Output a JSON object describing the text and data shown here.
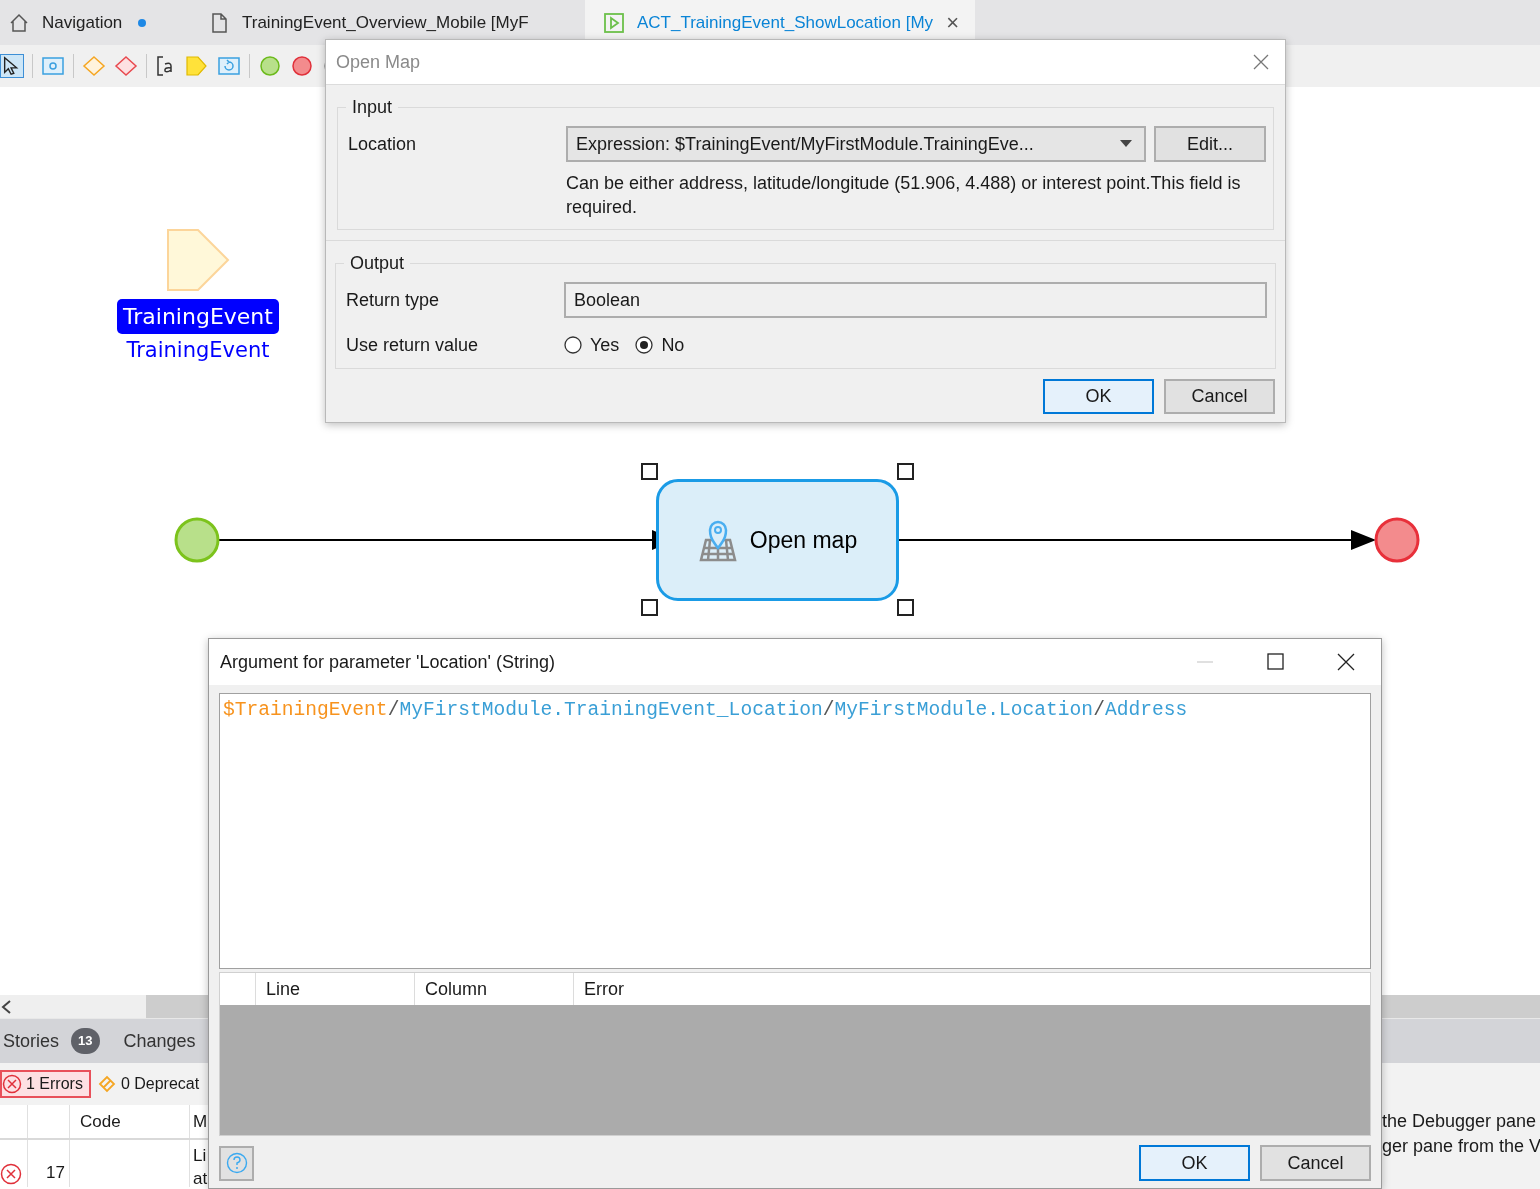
{
  "tabs": [
    {
      "label": "Navigation",
      "unsaved": true,
      "selected": false
    },
    {
      "label": "TrainingEvent_Overview_Mobile [MyF",
      "unsaved": false,
      "selected": false
    },
    {
      "label": "ACT_TrainingEvent_ShowLocation [My",
      "unsaved": false,
      "selected": true,
      "close": "×"
    }
  ],
  "canvas": {
    "parameter": {
      "badge": "TrainingEvent",
      "name": "TrainingEvent"
    },
    "activity": {
      "label": "Open map",
      "selected": true
    }
  },
  "open_map_dialog": {
    "title": "Open Map",
    "input": {
      "legend": "Input",
      "location_label": "Location",
      "location_value": "Expression: $TrainingEvent/MyFirstModule.TrainingEve...",
      "edit_button": "Edit...",
      "hint": "Can be either address, latitude/longitude (51.906, 4.488) or interest point.This field is required."
    },
    "output": {
      "legend": "Output",
      "return_type_label": "Return type",
      "return_type": "Boolean",
      "use_return_label": "Use return value",
      "options": [
        {
          "label": "Yes",
          "selected": false
        },
        {
          "label": "No",
          "selected": true
        }
      ]
    },
    "buttons": [
      "OK",
      "Cancel"
    ]
  },
  "argument_dialog": {
    "title": "Argument for parameter 'Location' (String)",
    "expression": [
      {
        "kind": "variable",
        "text": "$TrainingEvent"
      },
      {
        "kind": "separator",
        "text": "/"
      },
      {
        "kind": "member",
        "text": "MyFirstModule.TrainingEvent_Location"
      },
      {
        "kind": "separator",
        "text": "/"
      },
      {
        "kind": "member",
        "text": "MyFirstModule.Location"
      },
      {
        "kind": "separator",
        "text": "/"
      },
      {
        "kind": "member",
        "text": "Address"
      }
    ],
    "error_columns": [
      "Line",
      "Column",
      "Error"
    ],
    "buttons": [
      "OK",
      "Cancel"
    ]
  },
  "bottom_panel": {
    "tabs": [
      {
        "label": "Stories",
        "count": "13"
      },
      {
        "label": "Changes"
      }
    ],
    "filters": [
      {
        "label": "1 Errors",
        "kind": "error",
        "selected": true
      },
      {
        "label": "0 Deprecat",
        "kind": "deprecation",
        "selected": false
      }
    ],
    "columns": [
      "Code",
      "M"
    ],
    "rows": [
      {
        "kind": "error",
        "line": "17",
        "message": [
          "Li",
          "at"
        ]
      }
    ],
    "details": [
      "the Debugger pane",
      "ger pane from the V"
    ]
  }
}
